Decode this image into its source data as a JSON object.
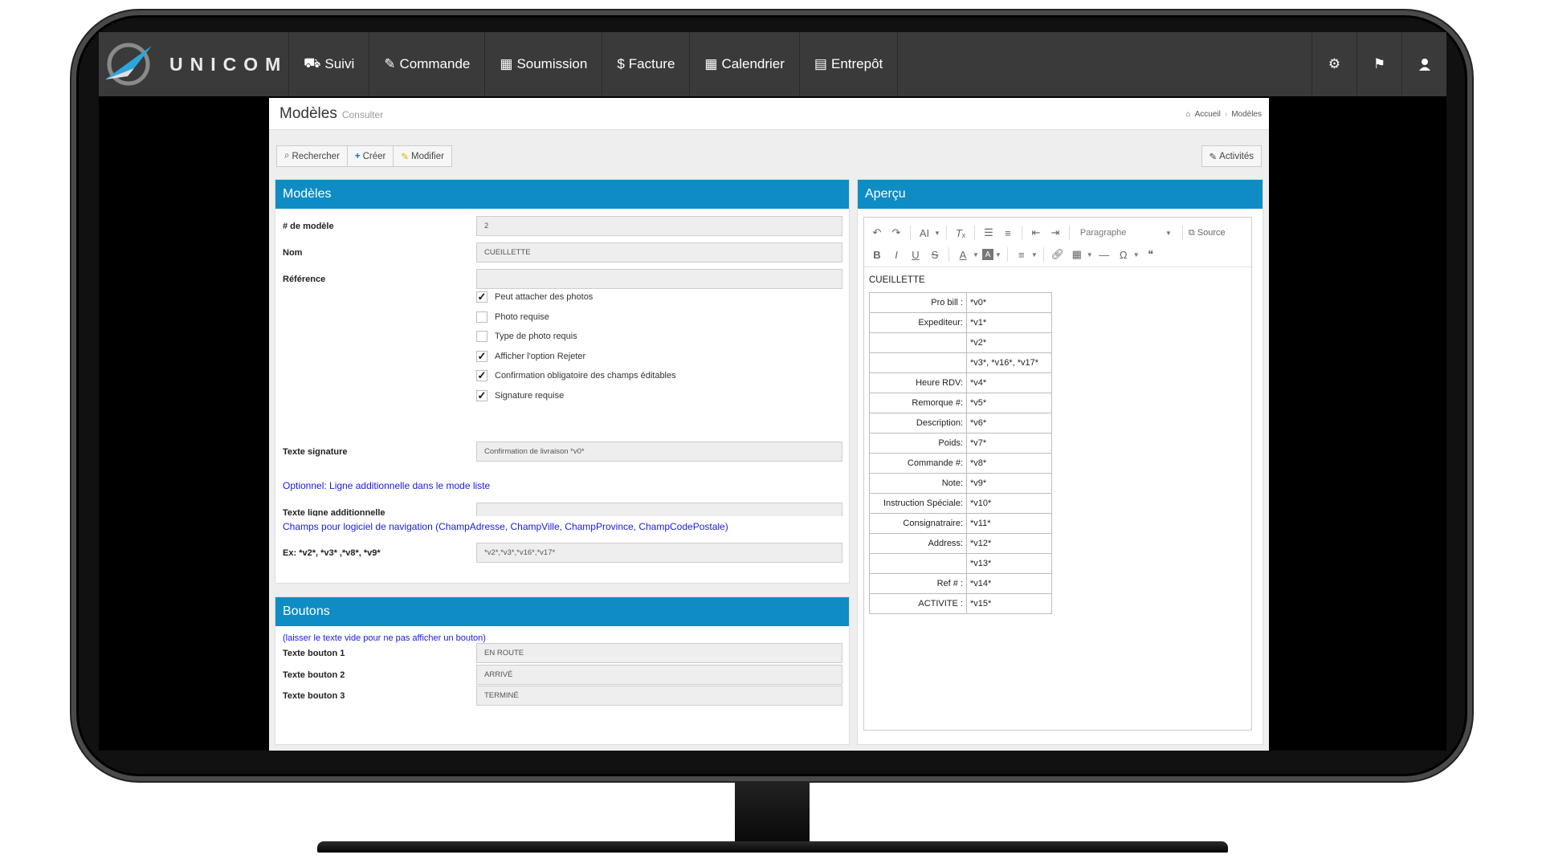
{
  "brand": {
    "name": "UNICOM"
  },
  "nav": {
    "items": [
      {
        "label": "Suivi",
        "icon": "truck-icon",
        "glyph": "⛟"
      },
      {
        "label": "Commande",
        "icon": "edit-icon",
        "glyph": "✎"
      },
      {
        "label": "Soumission",
        "icon": "calculator-icon",
        "glyph": "▦"
      },
      {
        "label": "Facture",
        "icon": "dollar-icon",
        "glyph": "$"
      },
      {
        "label": "Calendrier",
        "icon": "calendar-icon",
        "glyph": "▦"
      },
      {
        "label": "Entrepôt",
        "icon": "clipboard-icon",
        "glyph": "▤"
      }
    ],
    "right_icons": [
      "gear-icon",
      "flag-icon",
      "user-icon"
    ]
  },
  "header": {
    "title": "Modèles",
    "subtitle": "Consulter",
    "breadcrumb": [
      "Accueil",
      "Modèles"
    ]
  },
  "toolbar": {
    "search": "Rechercher",
    "create": "Créer",
    "edit": "Modifier",
    "activities": "Activités"
  },
  "models_panel": {
    "title": "Modèles",
    "fields": {
      "model_number": {
        "label": "# de modèle",
        "value": "2"
      },
      "name": {
        "label": "Nom",
        "value": "CUEILLETTE"
      },
      "reference": {
        "label": "Référence",
        "value": ""
      }
    },
    "checkboxes": [
      {
        "label": "Peut attacher des photos",
        "checked": true
      },
      {
        "label": "Photo requise",
        "checked": false
      },
      {
        "label": "Type de photo requis",
        "checked": false
      },
      {
        "label": "Afficher l'option Rejeter",
        "checked": true
      },
      {
        "label": "Confirmation obligatoire des champs éditables",
        "checked": true
      },
      {
        "label": "Signature requise",
        "checked": true
      }
    ],
    "signature_text": {
      "label": "Texte signature",
      "value": "Confirmation de livraison *v0*"
    },
    "optional_note": "Optionnel: Ligne additionnelle dans le mode liste",
    "extra_line": {
      "label": "Texte ligne additionnelle",
      "value": ""
    },
    "nav_note": "Champs pour logiciel de navigation (ChampAdresse, ChampVille, ChampProvince, ChampCodePostale)",
    "nav_fields": {
      "label": "Ex: *v2*, *v3* ,*v8*, *v9*",
      "value": "*v2*,*v3*,*v16*,*v17*"
    }
  },
  "buttons_panel": {
    "title": "Boutons",
    "note": "(laisser le texte vide pour ne pas afficher un bouton)",
    "fields": [
      {
        "label": "Texte bouton 1",
        "value": "EN ROUTE"
      },
      {
        "label": "Texte bouton 2",
        "value": "ARRIVÉ"
      },
      {
        "label": "Texte bouton 3",
        "value": "TERMINÉ"
      }
    ]
  },
  "preview_panel": {
    "title": "Aperçu",
    "editor": {
      "paragraph_select": "Paragraphe",
      "source_label": "Source"
    },
    "doc_title": "CUEILLETTE",
    "rows": [
      {
        "key": "Pro bill :",
        "value": "*v0*"
      },
      {
        "key": "Expediteur:",
        "value": "*v1*"
      },
      {
        "key": "",
        "value": "*v2*"
      },
      {
        "key": "",
        "value": "*v3*, *v16*, *v17*"
      },
      {
        "key": "Heure RDV:",
        "value": "*v4*"
      },
      {
        "key": "Remorque #:",
        "value": "*v5*"
      },
      {
        "key": "Description:",
        "value": "*v6*"
      },
      {
        "key": "Poids:",
        "value": "*v7*"
      },
      {
        "key": "Commande #:",
        "value": "*v8*"
      },
      {
        "key": "Note:",
        "value": "*v9*"
      },
      {
        "key": "Instruction Spéciale:",
        "value": "*v10*"
      },
      {
        "key": "Consignatraire:",
        "value": "*v11*"
      },
      {
        "key": "Address:",
        "value": "*v12*"
      },
      {
        "key": "",
        "value": "*v13*"
      },
      {
        "key": "Ref # :",
        "value": "*v14*"
      },
      {
        "key": "ACTIVITE :",
        "value": "*v15*"
      }
    ]
  },
  "colors": {
    "accent": "#0f8cc3",
    "topbar": "#3a3a3a",
    "note_blue": "#1a1adf"
  }
}
